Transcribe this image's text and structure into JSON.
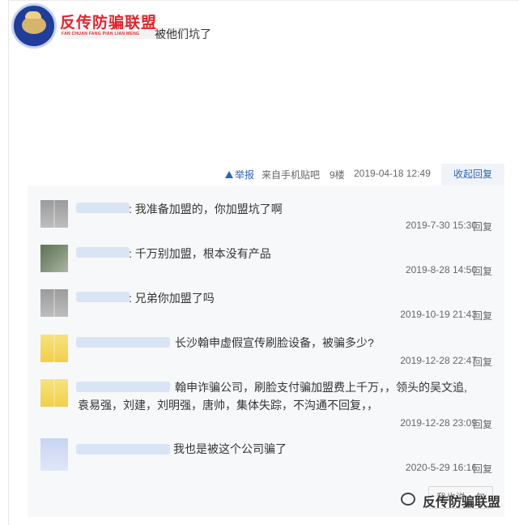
{
  "logo": {
    "title": "反传防骗联盟",
    "subtitle": "FAN CHUAN FANG PIAN LIAN MENG"
  },
  "post": {
    "text_tail": "被他们坑了"
  },
  "meta": {
    "report": "举报",
    "source": "来自手机贴吧",
    "floor": "9楼",
    "date": "2019-04-18 12:49",
    "collapse": "收起回复"
  },
  "replies": [
    {
      "text": ": 我准备加盟的，你加盟坑了啊",
      "time": "2019-7-30 15:30",
      "action": "回复",
      "avatar": "gray"
    },
    {
      "text": ": 千万别加盟，根本没有产品",
      "time": "2019-8-28 14:50",
      "action": "回复",
      "avatar": "dark"
    },
    {
      "text": ": 兄弟你加盟了吗",
      "time": "2019-10-19 21:43",
      "action": "回复",
      "avatar": "gray"
    },
    {
      "text": "长沙翰申虚假宣传刷脸设备，被骗多少?",
      "time": "2019-12-28 22:47",
      "action": "回复",
      "avatar": "yellow"
    },
    {
      "text": "翰申诈骗公司，刷脸支付骗加盟费上千万，，领头的吴文追,",
      "text2": "袁易强，刘建，刘明强，唐帅，集体失踪，不沟通不回复，，",
      "time": "2019-12-28 23:09",
      "action": "回复",
      "avatar": "yellow"
    },
    {
      "text": "我也是被这个公司骗了",
      "time": "2020-5-29 16:16",
      "action": "回复",
      "avatar": "blue"
    }
  ],
  "reply_button": "我也说一句",
  "watermark": "反传防骗联盟"
}
